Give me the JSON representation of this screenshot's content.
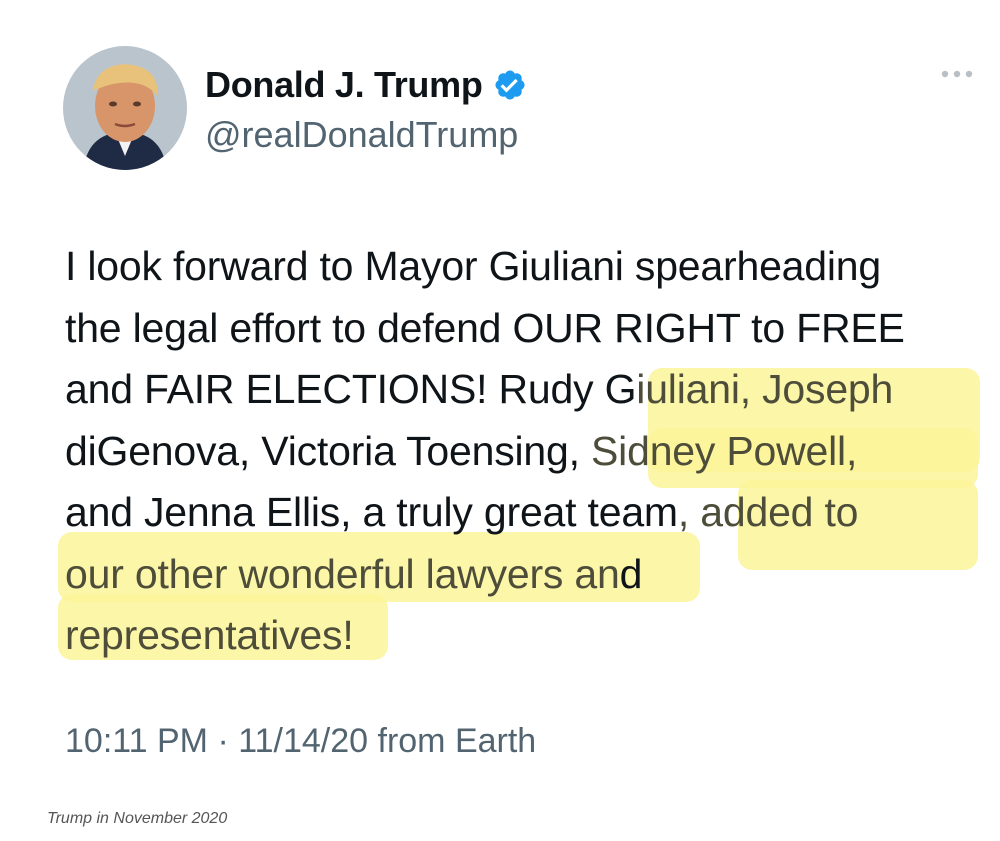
{
  "tweet": {
    "author": {
      "display_name": "Donald J. Trump",
      "handle": "@realDonaldTrump",
      "verified": true,
      "avatar_icon": "profile-photo",
      "verified_icon": "verified-badge-icon",
      "more_icon": "more-options-icon"
    },
    "text_lines": [
      "I look forward to Mayor Giuliani spearheading",
      "the legal effort to defend OUR RIGHT to FREE",
      "and FAIR ELECTIONS! Rudy G",
      "iuliani, Joseph",
      "diGenova, Victoria Toensing, ",
      "Sidney Powell,",
      "and Jenna Ellis, a truly great team",
      ", added to",
      "our other wonderful lawyers an",
      "d",
      "representatives!"
    ],
    "timestamp": "10:11 PM · 11/14/20 from Earth"
  },
  "caption": "Trump in November 2020",
  "colors": {
    "highlight": "#fbf49a",
    "verified": "#1d9bf0",
    "secondary_text": "#536471"
  }
}
